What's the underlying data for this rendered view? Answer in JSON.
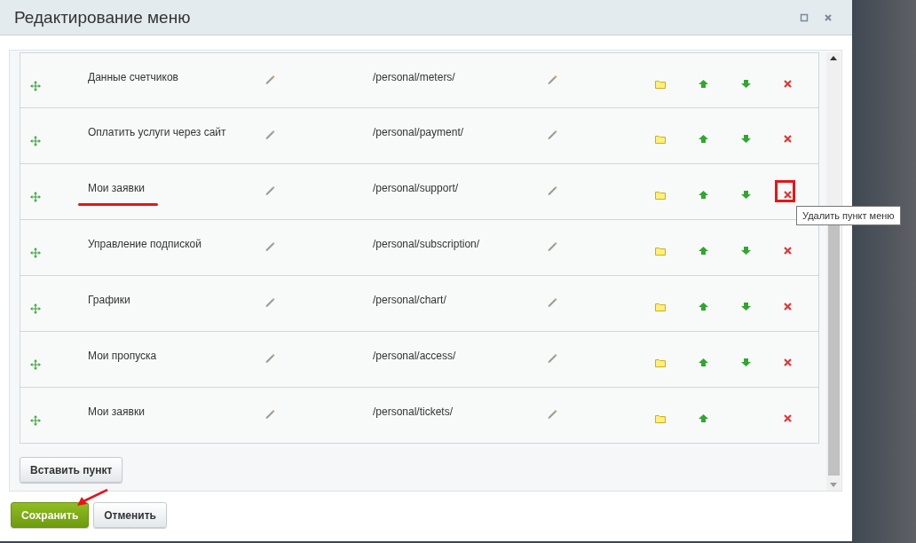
{
  "window": {
    "title": "Редактирование меню"
  },
  "rows": [
    {
      "name": "Данные счетчиков",
      "url": "/personal/meters/",
      "down_arrow": true,
      "annotated": false
    },
    {
      "name": "Оплатить услуги через сайт",
      "url": "/personal/payment/",
      "down_arrow": true,
      "annotated": false
    },
    {
      "name": "Мои заявки",
      "url": "/personal/support/",
      "down_arrow": true,
      "annotated": true
    },
    {
      "name": "Управление подпиской",
      "url": "/personal/subscription/",
      "down_arrow": true,
      "annotated": false
    },
    {
      "name": "Графики",
      "url": "/personal/chart/",
      "down_arrow": true,
      "annotated": false
    },
    {
      "name": "Мои пропуска",
      "url": "/personal/access/",
      "down_arrow": true,
      "annotated": false
    },
    {
      "name": "Мои заявки",
      "url": "/personal/tickets/",
      "down_arrow": false,
      "annotated": false
    }
  ],
  "tooltip": "Удалить пункт меню",
  "insert_button": "Вставить пункт",
  "buttons": [
    {
      "label": "Сохранить",
      "kind": "primary"
    },
    {
      "label": "Отменить",
      "kind": "secondary"
    }
  ]
}
